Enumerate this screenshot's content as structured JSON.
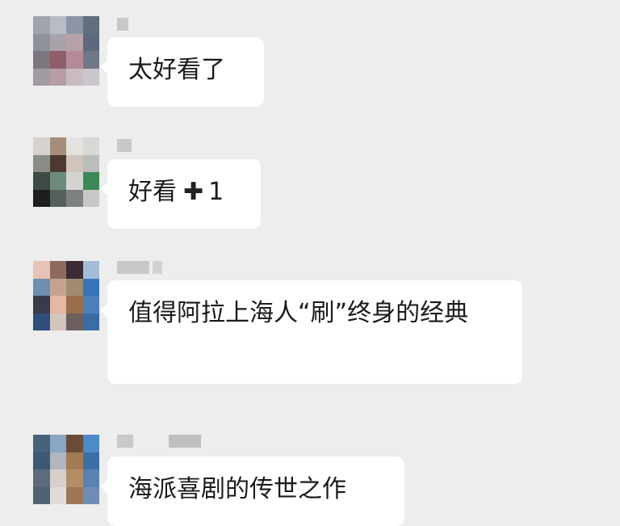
{
  "messages": [
    {
      "id": "m1",
      "text": "太好看了",
      "avatar_pixels": [
        "#a0a4ae",
        "#b9bcc4",
        "#8c95a4",
        "#616e80",
        "#8e919c",
        "#a9a2aa",
        "#b7a1a9",
        "#5d6a7d",
        "#7d7680",
        "#8e5e6a",
        "#b58a96",
        "#6f7887",
        "#a49aa2",
        "#b79da6",
        "#c9bbc2",
        "#c9c6cc"
      ]
    },
    {
      "id": "m2",
      "text_parts": [
        "好看",
        "1"
      ],
      "avatar_pixels": [
        "#d8d2cd",
        "#a58f7b",
        "#e4e2df",
        "#d7d7d6",
        "#8a8c86",
        "#4d3a2e",
        "#cfc5bd",
        "#b9bdbb",
        "#3e4a46",
        "#6d8b7a",
        "#d4d4d2",
        "#3b8856",
        "#1d1f1f",
        "#55605c",
        "#7c837f",
        "#c8c8c8"
      ]
    },
    {
      "id": "m3",
      "text": "值得阿拉上海人“刷”终身的经典",
      "avatar_pixels": [
        "#e9c2b7",
        "#8f6a5c",
        "#3b2b33",
        "#a5bcd7",
        "#6e8fae",
        "#c6a390",
        "#a08a71",
        "#3774b6",
        "#383b4a",
        "#e4b8a2",
        "#9a6e4a",
        "#4d80bb",
        "#2f4f7c",
        "#d3c4bc",
        "#6b5f60",
        "#3b6da5"
      ]
    },
    {
      "id": "m4",
      "text": "海派喜剧的传世之作",
      "avatar_pixels": [
        "#49627c",
        "#8aa6c2",
        "#6a4c3a",
        "#4d8ac8",
        "#3f5876",
        "#b0b6bd",
        "#a47b52",
        "#3d6fa6",
        "#5d6b7c",
        "#d6cfcb",
        "#b48d66",
        "#5a82b3",
        "#516274",
        "#e0dcdc",
        "#9b7658",
        "#6f8db4"
      ]
    }
  ]
}
